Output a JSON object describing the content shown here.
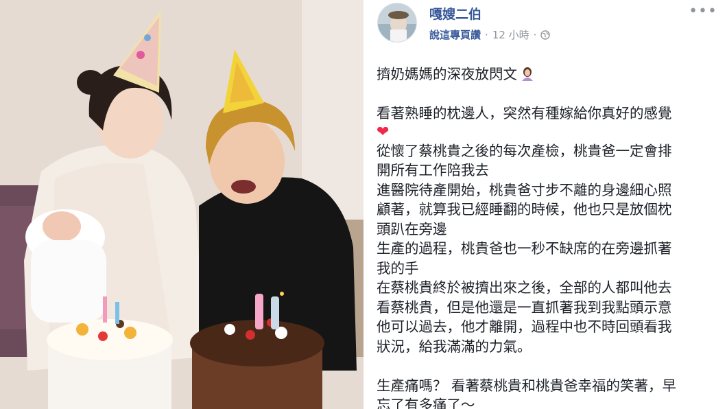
{
  "page": {
    "name": "嘎嫂二伯",
    "listen_label": "說這專頁讚",
    "time": "12 小時",
    "separator": "·",
    "more_label": "•••"
  },
  "post": {
    "lines": [
      "擠奶媽媽的深夜放閃文",
      "",
      "看著熟睡的枕邊人，突然有種嫁給你真好的感覺",
      "❤",
      "從懷了蔡桃貴之後的每次產檢，桃貴爸一定會排",
      "開所有工作陪我去",
      "進醫院待產開始，桃貴爸寸步不離的身邊細心照",
      "顧著，就算我已經睡翻的時候，他也只是放個枕",
      "頭趴在旁邊",
      "生產的過程，桃貴爸也一秒不缺席的在旁邊抓著",
      "我的手",
      "在蔡桃貴終於被擠出來之後，全部的人都叫他去",
      "看蔡桃貴，但是他還是一直抓著我到我點頭示意",
      "他可以過去，他才離開，過程中也不時回頭看我",
      "狀況，給我滿滿的力氣。",
      "",
      "生產痛嗎？ 看著蔡桃貴和桃貴爸幸福的笑著，早",
      "忘了有多痛了～"
    ],
    "emoji_icon": "woman-emoji-icon",
    "heart_color": "#f02849"
  },
  "colors": {
    "link": "#365899",
    "meta": "#90949c",
    "text": "#1d2129"
  }
}
